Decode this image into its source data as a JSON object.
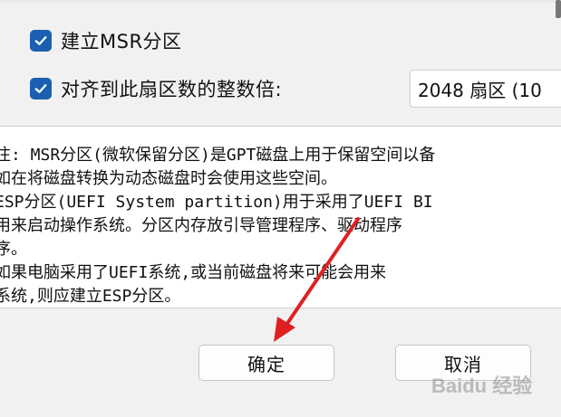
{
  "options": {
    "msr": {
      "label": "建立MSR分区",
      "checked": true
    },
    "align": {
      "label": "对齐到此扇区数的整数倍:",
      "checked": true,
      "value": "2048 扇区 (10"
    }
  },
  "note": {
    "lines": [
      "注: MSR分区(微软保留分区)是GPT磁盘上用于保留空间以备",
      "如在将磁盘转换为动态磁盘时会使用这些空间。",
      "    ESP分区(UEFI System partition)用于采用了UEFI BI",
      "用来启动操作系统。分区内存放引导管理程序、驱动程序",
      "序。",
      "  如果电脑采用了UEFI系统,或当前磁盘将来可能会用来",
      "系统,则应建立ESP分区。"
    ]
  },
  "buttons": {
    "ok": "确定",
    "cancel": "取消"
  },
  "watermark": {
    "text": "Baidu 经验"
  },
  "colors": {
    "checkbox": "#1c5fb0",
    "arrow": "#e02020"
  }
}
